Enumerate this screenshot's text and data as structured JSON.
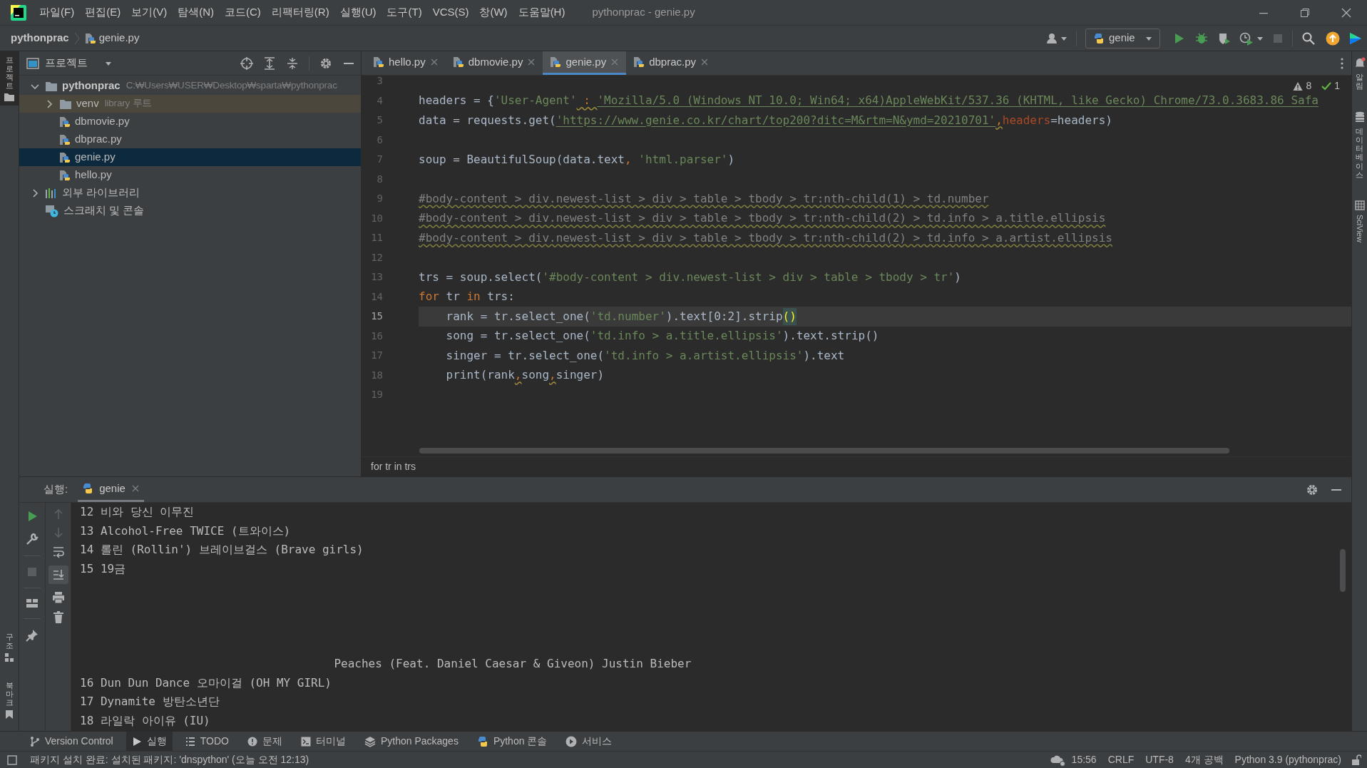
{
  "title_bar": {
    "menus": [
      "파일(F)",
      "편집(E)",
      "보기(V)",
      "탐색(N)",
      "코드(C)",
      "리팩터링(R)",
      "실행(U)",
      "도구(T)",
      "VCS(S)",
      "창(W)",
      "도움말(H)"
    ],
    "title": "pythonprac - genie.py"
  },
  "nav_bar": {
    "breadcrumb": [
      {
        "label": "pythonprac",
        "kind": "project"
      },
      {
        "label": "genie.py",
        "kind": "python"
      }
    ],
    "run_config": "genie"
  },
  "left_stripe": {
    "top": [
      {
        "label": "프로젝트",
        "kind": "project",
        "selected": true
      }
    ],
    "bottom": [
      {
        "label": "구조",
        "kind": "structure",
        "selected": false
      },
      {
        "label": "북마크",
        "kind": "bookmarks",
        "selected": false
      }
    ]
  },
  "right_stripe": [
    {
      "label": "알림",
      "kind": "notifications"
    },
    {
      "label": "데이터베이스",
      "kind": "database"
    },
    {
      "label": "SciView",
      "kind": "sciview"
    }
  ],
  "project_panel": {
    "title": "프로젝트",
    "tree": [
      {
        "label": "pythonprac",
        "kind": "folder",
        "hint": "C:₩Users₩USER₩Desktop₩sparta₩pythonprac",
        "expanded": true,
        "selected": false,
        "children": [
          {
            "label": "venv",
            "kind": "library-root",
            "hint": "library 루트",
            "expanded": false,
            "selected": false
          },
          {
            "label": "dbmovie.py",
            "kind": "python",
            "selected": false
          },
          {
            "label": "dbprac.py",
            "kind": "python",
            "selected": false
          },
          {
            "label": "genie.py",
            "kind": "python",
            "selected": true
          },
          {
            "label": "hello.py",
            "kind": "python",
            "selected": false
          }
        ]
      },
      {
        "label": "외부 라이브러리",
        "kind": "libraries",
        "expanded": false,
        "selected": false
      },
      {
        "label": "스크래치 및 콘솔",
        "kind": "scratch",
        "selected": false
      }
    ]
  },
  "editor": {
    "tabs": [
      {
        "label": "hello.py",
        "selected": false
      },
      {
        "label": "dbmovie.py",
        "selected": false
      },
      {
        "label": "genie.py",
        "selected": true
      },
      {
        "label": "dbprac.py",
        "selected": false
      }
    ],
    "inspection": {
      "warnings": "8",
      "passed": "1"
    },
    "lines": [
      {
        "number": "3",
        "current": false
      },
      {
        "number": "4",
        "current": false,
        "tokens": [
          {
            "kind": "text",
            "text": "headers = {"
          },
          {
            "kind": "str",
            "text": "'User-Agent'"
          },
          {
            "kind": "warn",
            "text": " : "
          },
          {
            "kind": "url",
            "text": "'Mozilla/5.0 (Windows NT 10.0; Win64; x64)AppleWebKit/537.36 (KHTML, like Gecko) Chrome/73.0.3683.86 Safa"
          }
        ]
      },
      {
        "number": "5",
        "current": false,
        "tokens": [
          {
            "kind": "text",
            "text": "data = requests.get("
          },
          {
            "kind": "url",
            "text": "'https://www.genie.co.kr/chart/top200?ditc=M&rtm=N&ymd=20210701'"
          },
          {
            "kind": "warn",
            "text": ","
          },
          {
            "kind": "param",
            "text": "headers"
          },
          {
            "kind": "text",
            "text": "=headers)"
          }
        ]
      },
      {
        "number": "6",
        "current": false
      },
      {
        "number": "7",
        "current": false,
        "tokens": [
          {
            "kind": "text",
            "text": "soup = BeautifulSoup(data.text"
          },
          {
            "kind": "kw",
            "text": ", "
          },
          {
            "kind": "str",
            "text": "'html.parser'"
          },
          {
            "kind": "text",
            "text": ")"
          }
        ]
      },
      {
        "number": "8",
        "current": false
      },
      {
        "number": "9",
        "current": false,
        "tokens": [
          {
            "kind": "comment",
            "text": "#body-content > div.newest-list > div > table > tbody > tr:nth-child(1) > td.number"
          }
        ]
      },
      {
        "number": "10",
        "current": false,
        "tokens": [
          {
            "kind": "comment",
            "text": "#body-content > div.newest-list > div > table > tbody > tr:nth-child(2) > td.info > a.title.ellipsis"
          }
        ]
      },
      {
        "number": "11",
        "current": false,
        "tokens": [
          {
            "kind": "comment",
            "text": "#body-content > div.newest-list > div > table > tbody > tr:nth-child(2) > td.info > a.artist.ellipsis"
          }
        ]
      },
      {
        "number": "12",
        "current": false
      },
      {
        "number": "13",
        "current": false,
        "tokens": [
          {
            "kind": "text",
            "text": "trs = soup.select("
          },
          {
            "kind": "str",
            "text": "'#body-content > div.newest-list > div > table > tbody > tr'"
          },
          {
            "kind": "text",
            "text": ")"
          }
        ]
      },
      {
        "number": "14",
        "current": false,
        "tokens": [
          {
            "kind": "kw",
            "text": "for"
          },
          {
            "kind": "text",
            "text": " tr "
          },
          {
            "kind": "kw",
            "text": "in"
          },
          {
            "kind": "text",
            "text": " trs:"
          }
        ]
      },
      {
        "number": "15",
        "current": true,
        "tokens": [
          {
            "kind": "text",
            "text": "    rank = tr.select_one("
          },
          {
            "kind": "str",
            "text": "'td.number'"
          },
          {
            "kind": "text",
            "text": ").text[0:2].strip"
          },
          {
            "kind": "match",
            "text": "()"
          }
        ]
      },
      {
        "number": "16",
        "current": false,
        "tokens": [
          {
            "kind": "text",
            "text": "    song = tr.select_one("
          },
          {
            "kind": "str",
            "text": "'td.info > a.title.ellipsis'"
          },
          {
            "kind": "text",
            "text": ").text.strip()"
          }
        ]
      },
      {
        "number": "17",
        "current": false,
        "tokens": [
          {
            "kind": "text",
            "text": "    singer = tr.select_one("
          },
          {
            "kind": "str",
            "text": "'td.info > a.artist.ellipsis'"
          },
          {
            "kind": "text",
            "text": ").text"
          }
        ]
      },
      {
        "number": "18",
        "current": false,
        "tokens": [
          {
            "kind": "text",
            "text": "    print(rank"
          },
          {
            "kind": "warn",
            "text": ","
          },
          {
            "kind": "text",
            "text": "song"
          },
          {
            "kind": "warn",
            "text": ","
          },
          {
            "kind": "text",
            "text": "singer)"
          }
        ]
      },
      {
        "number": "19",
        "current": false
      }
    ],
    "breadcrumb": "for tr in trs"
  },
  "run_panel": {
    "label": "실행:",
    "tabs": [
      {
        "label": "genie",
        "selected": true
      }
    ],
    "scroll_to_end": true,
    "output": [
      "12 비와 당신 이무진",
      "13 Alcohol-Free TWICE (트와이스)",
      "14 롤린 (Rollin') 브레이브걸스 (Brave girls)",
      "15 19금",
      "\n\n\n\n                                     Peaches (Feat. Daniel Caesar & Giveon) Justin Bieber",
      "16 Dun Dun Dance 오마이걸 (OH MY GIRL)",
      "17 Dynamite 방탄소년단",
      "18 라일락 아이유 (IU)"
    ]
  },
  "tool_windows": [
    {
      "label": "Version Control",
      "kind": "vcs",
      "selected": false
    },
    {
      "label": "실행",
      "kind": "run",
      "selected": true
    },
    {
      "label": "TODO",
      "kind": "todo",
      "selected": false
    },
    {
      "label": "문제",
      "kind": "problems",
      "selected": false
    },
    {
      "label": "터미널",
      "kind": "terminal",
      "selected": false
    },
    {
      "label": "Python Packages",
      "kind": "packages",
      "selected": false
    },
    {
      "label": "Python 콘솔",
      "kind": "console",
      "selected": false
    },
    {
      "label": "서비스",
      "kind": "services",
      "selected": false
    }
  ],
  "status_bar": {
    "message": "패키지 설치 완료: 설치된 패키지: 'dnspython' (오늘 오전 12:13)",
    "items": [
      "15:56",
      "CRLF",
      "UTF-8",
      "4개 공백",
      "Python 3.9 (pythonprac)"
    ]
  }
}
